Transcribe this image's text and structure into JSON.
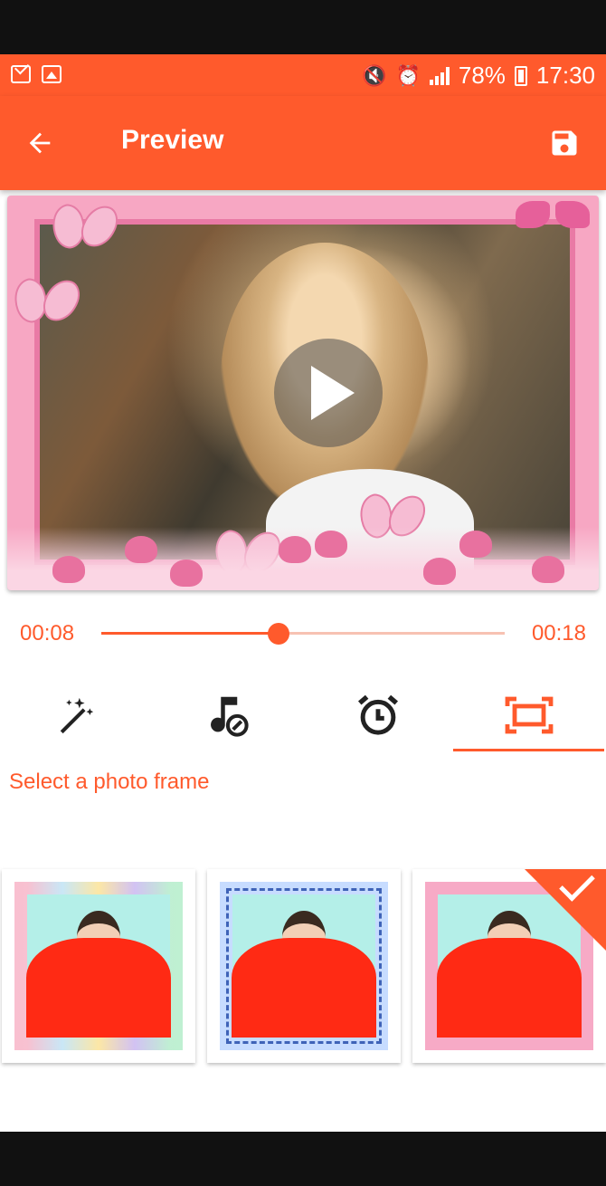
{
  "status_bar": {
    "battery": "78%",
    "time": "17:30"
  },
  "app_bar": {
    "title": "Preview"
  },
  "player": {
    "current_time": "00:08",
    "total_time": "00:18",
    "progress": 0.44
  },
  "tools": {
    "items": [
      "effects",
      "music",
      "duration",
      "frame"
    ],
    "selected": "frame"
  },
  "frame_picker": {
    "label": "Select a photo frame",
    "selected_index": 2,
    "frames": [
      "pastel-frame",
      "blue-ornament-frame",
      "pink-flower-frame"
    ]
  },
  "colors": {
    "accent": "#ff5a2c",
    "preview_border": "#f7a7c3"
  }
}
